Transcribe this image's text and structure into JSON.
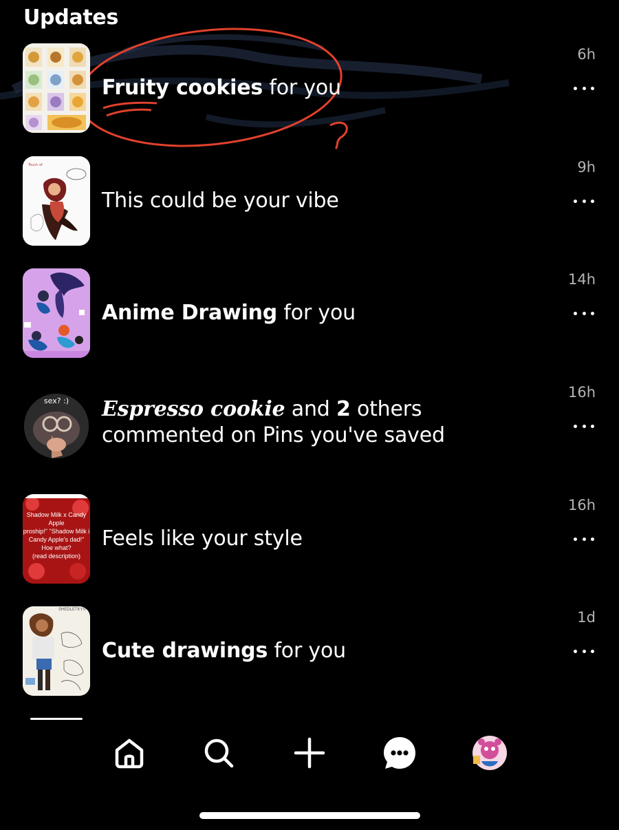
{
  "header": {
    "title": "Updates"
  },
  "notifications": [
    {
      "bold": "Fruity cookies",
      "rest": " for you",
      "time": "6h",
      "thumb": "cookie-grid-thumbnail"
    },
    {
      "bold": "",
      "rest": "This could be your vibe",
      "time": "9h",
      "thumb": "character-sketch-thumbnail"
    },
    {
      "bold": "Anime Drawing",
      "rest": " for you",
      "time": "14h",
      "thumb": "anime-drawing-thumbnail"
    },
    {
      "script_name": "Espresso cookie",
      "mid": " and ",
      "count": "2",
      "rest_line1": " others",
      "line2": "commented on Pins you've saved",
      "time": "16h",
      "avatar_caption": "sex? :)"
    },
    {
      "bold": "",
      "rest": "Feels like your style",
      "time": "16h",
      "thumb_lines": [
        "Shadow Milk x Candy Apple",
        "proship!\" \"Shadow Milk i",
        "Candy Apple's dad!\"",
        "Hoe what?",
        "(read description)"
      ]
    },
    {
      "bold": "Cute drawings",
      "rest": " for you",
      "time": "1d",
      "thumb_caption": "SHEDLETKYS"
    }
  ],
  "nav": {
    "items": [
      "home-icon",
      "search-icon",
      "create-plus-icon",
      "messages-icon",
      "profile-avatar"
    ]
  },
  "colors": {
    "background": "#000000",
    "text": "#ffffff",
    "muted": "#b5b5b5",
    "scribble": "#e2412c"
  }
}
